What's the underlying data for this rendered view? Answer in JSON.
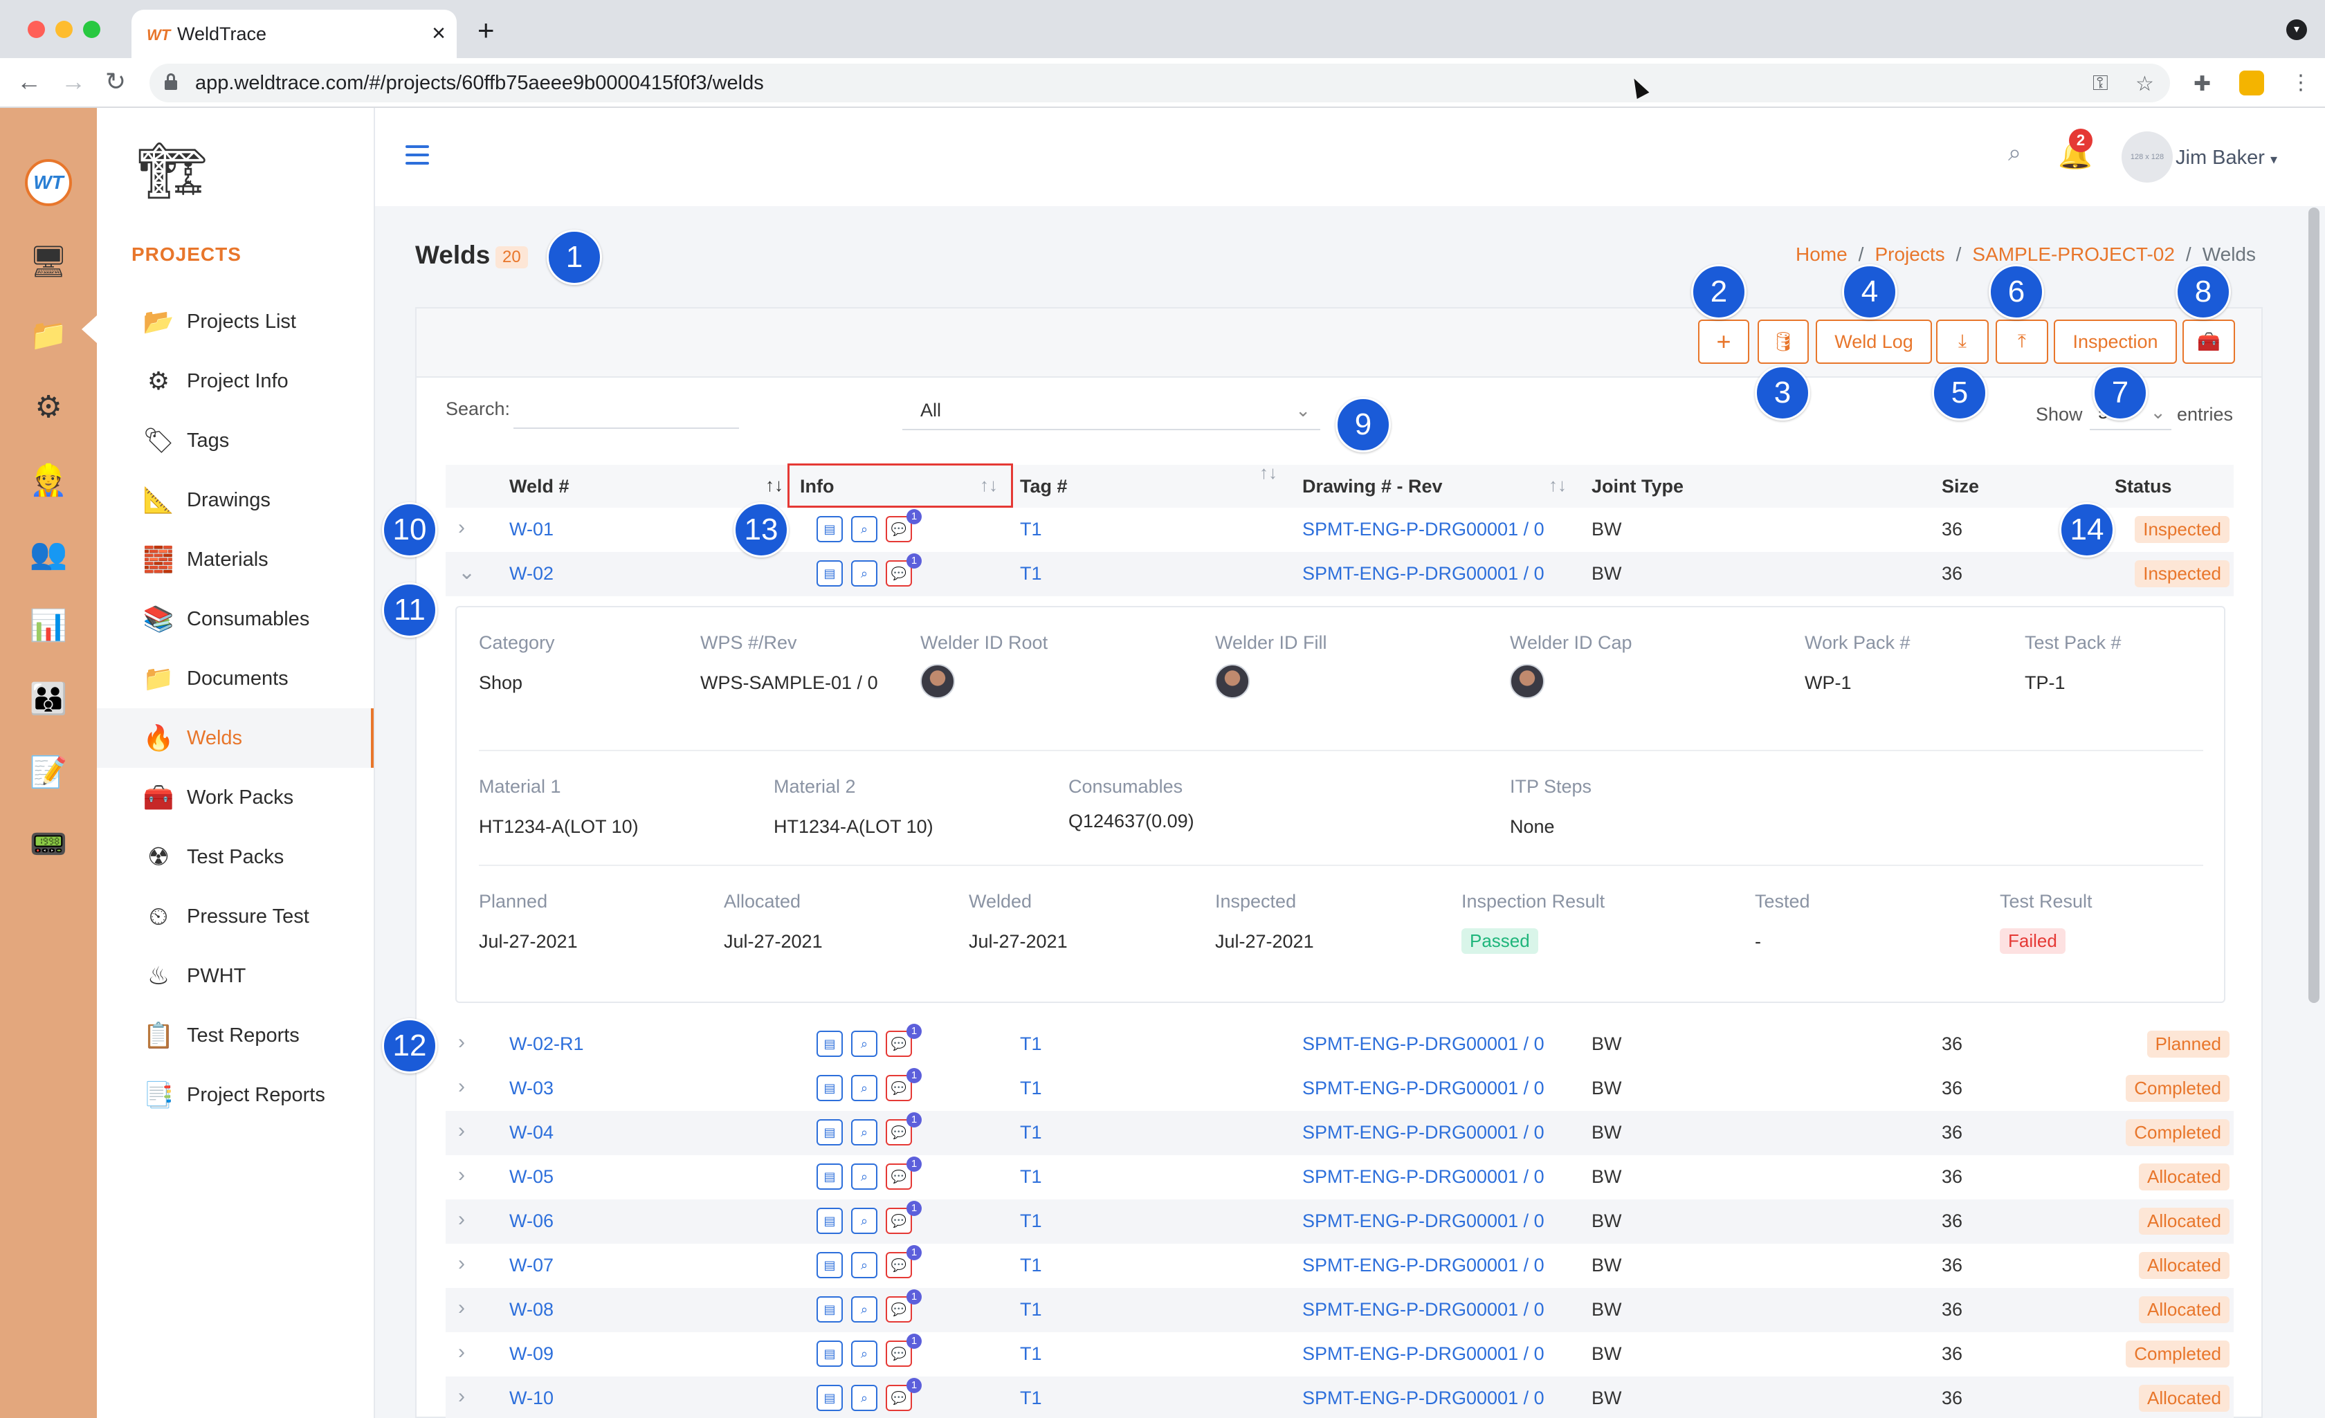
{
  "browser": {
    "tab_title": "WeldTrace",
    "tab_favicon": "WT",
    "url": "app.weldtrace.com/#/projects/60ffb75aeee9b0000415f0f3/welds"
  },
  "header": {
    "user_name": "Jim Baker",
    "avatar_text": "128 x 128",
    "notification_count": "2"
  },
  "sidebar": {
    "section_title": "PROJECTS",
    "items": [
      {
        "label": "Projects List",
        "icon": "folder-camera-icon"
      },
      {
        "label": "Project Info",
        "icon": "gears-icon"
      },
      {
        "label": "Tags",
        "icon": "tag-icon"
      },
      {
        "label": "Drawings",
        "icon": "drafting-icon"
      },
      {
        "label": "Materials",
        "icon": "bricks-icon"
      },
      {
        "label": "Consumables",
        "icon": "stack-icon"
      },
      {
        "label": "Documents",
        "icon": "folder-icon"
      },
      {
        "label": "Welds",
        "icon": "welding-icon"
      },
      {
        "label": "Work Packs",
        "icon": "toolbox-icon"
      },
      {
        "label": "Test Packs",
        "icon": "radiation-icon"
      },
      {
        "label": "Pressure Test",
        "icon": "gauge-icon"
      },
      {
        "label": "PWHT",
        "icon": "heater-icon"
      },
      {
        "label": "Test Reports",
        "icon": "clipboard-icon"
      },
      {
        "label": "Project Reports",
        "icon": "report-icon"
      }
    ],
    "active": "Welds"
  },
  "page": {
    "title": "Welds",
    "count": "20",
    "breadcrumb": {
      "home": "Home",
      "projects": "Projects",
      "project": "SAMPLE-PROJECT-02",
      "current": "Welds"
    }
  },
  "toolbar": {
    "add": "+",
    "weld_log": "Weld Log",
    "inspection": "Inspection"
  },
  "filters": {
    "search_label": "Search:",
    "select_value": "All",
    "show_label": "Show",
    "entries_value": "50",
    "entries_label": "entries"
  },
  "table": {
    "headers": [
      "Weld #",
      "Info",
      "Tag #",
      "Drawing # - Rev",
      "Joint Type",
      "Size",
      "Status"
    ],
    "rows": [
      {
        "weld": "W-01",
        "tag": "T1",
        "drawing": "SPMT-ENG-P-DRG00001 / 0",
        "joint": "BW",
        "size": "36",
        "status": "Inspected",
        "comments": "1"
      },
      {
        "weld": "W-02",
        "tag": "T1",
        "drawing": "SPMT-ENG-P-DRG00001 / 0",
        "joint": "BW",
        "size": "36",
        "status": "Inspected",
        "comments": "1"
      },
      {
        "weld": "W-02-R1",
        "tag": "T1",
        "drawing": "SPMT-ENG-P-DRG00001 / 0",
        "joint": "BW",
        "size": "36",
        "status": "Planned",
        "comments": "1"
      },
      {
        "weld": "W-03",
        "tag": "T1",
        "drawing": "SPMT-ENG-P-DRG00001 / 0",
        "joint": "BW",
        "size": "36",
        "status": "Completed",
        "comments": "1"
      },
      {
        "weld": "W-04",
        "tag": "T1",
        "drawing": "SPMT-ENG-P-DRG00001 / 0",
        "joint": "BW",
        "size": "36",
        "status": "Completed",
        "comments": "1"
      },
      {
        "weld": "W-05",
        "tag": "T1",
        "drawing": "SPMT-ENG-P-DRG00001 / 0",
        "joint": "BW",
        "size": "36",
        "status": "Allocated",
        "comments": "1"
      },
      {
        "weld": "W-06",
        "tag": "T1",
        "drawing": "SPMT-ENG-P-DRG00001 / 0",
        "joint": "BW",
        "size": "36",
        "status": "Allocated",
        "comments": "1"
      },
      {
        "weld": "W-07",
        "tag": "T1",
        "drawing": "SPMT-ENG-P-DRG00001 / 0",
        "joint": "BW",
        "size": "36",
        "status": "Allocated",
        "comments": "1"
      },
      {
        "weld": "W-08",
        "tag": "T1",
        "drawing": "SPMT-ENG-P-DRG00001 / 0",
        "joint": "BW",
        "size": "36",
        "status": "Allocated",
        "comments": "1"
      },
      {
        "weld": "W-09",
        "tag": "T1",
        "drawing": "SPMT-ENG-P-DRG00001 / 0",
        "joint": "BW",
        "size": "36",
        "status": "Completed",
        "comments": "1"
      },
      {
        "weld": "W-10",
        "tag": "T1",
        "drawing": "SPMT-ENG-P-DRG00001 / 0",
        "joint": "BW",
        "size": "36",
        "status": "Allocated",
        "comments": "1"
      }
    ]
  },
  "detail": {
    "row1_labels": [
      "Category",
      "WPS #/Rev",
      "Welder ID Root",
      "Welder ID Fill",
      "Welder ID Cap",
      "Work Pack #",
      "Test Pack #"
    ],
    "category": "Shop",
    "wps": "WPS-SAMPLE-01 / 0",
    "work_pack": "WP-1",
    "test_pack": "TP-1",
    "row2_labels": [
      "Material 1",
      "Material 2",
      "Consumables",
      "ITP Steps"
    ],
    "material1": "HT1234-A(LOT 10)",
    "material2": "HT1234-A(LOT 10)",
    "consumables": "Q124637(0.09)",
    "itp_steps": "None",
    "row3_labels": [
      "Planned",
      "Allocated",
      "Welded",
      "Inspected",
      "Inspection Result",
      "Tested",
      "Test Result"
    ],
    "planned": "Jul-27-2021",
    "allocated": "Jul-27-2021",
    "welded": "Jul-27-2021",
    "inspected": "Jul-27-2021",
    "inspection_result": "Passed",
    "tested": "-",
    "test_result": "Failed"
  },
  "markers": [
    "1",
    "2",
    "3",
    "4",
    "5",
    "6",
    "7",
    "8",
    "9",
    "10",
    "11",
    "12",
    "13",
    "14"
  ],
  "colors": {
    "accent": "#e8762b",
    "link": "#2d6fdb",
    "marker": "#1a5bd8",
    "rail": "#e3a77d"
  }
}
